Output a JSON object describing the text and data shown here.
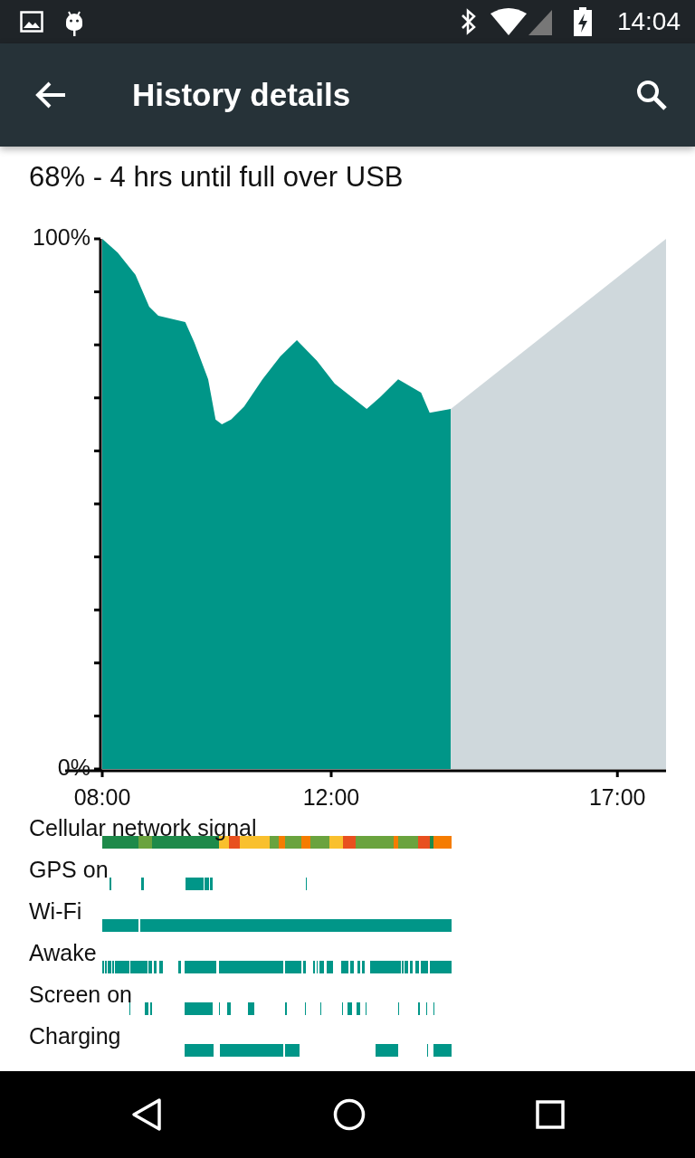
{
  "status_bar": {
    "time": "14:04"
  },
  "toolbar": {
    "title": "History details"
  },
  "summary": "68% - 4 hrs until full over USB",
  "chart": {
    "chart_data": {
      "type": "area",
      "x": [
        8.0,
        8.27,
        8.58,
        8.82,
        8.98,
        9.45,
        9.61,
        9.85,
        9.98,
        10.09,
        10.25,
        10.48,
        10.8,
        11.11,
        11.4,
        11.75,
        12.06,
        12.62,
        12.85,
        13.17,
        13.57,
        13.72,
        14.09,
        17.85
      ],
      "xlim": [
        8,
        17.85
      ],
      "ylim": [
        0,
        100
      ],
      "xticks": [
        {
          "value": 8,
          "label": "08:00"
        },
        {
          "value": 12,
          "label": "12:00"
        },
        {
          "value": 17,
          "label": "17:00"
        }
      ],
      "yticks": [
        {
          "value": 100,
          "label": "100%"
        },
        {
          "value": 0,
          "label": "0%"
        }
      ],
      "series": [
        {
          "color": "#009688",
          "values": [
            100,
            97.4,
            93.2,
            87.2,
            85.5,
            84.3,
            80.4,
            73.5,
            65.9,
            65,
            65.9,
            68.4,
            73.5,
            77.8,
            80.9,
            77,
            72.7,
            67.9,
            70.1,
            73.5,
            71,
            67.2,
            67.9,
            null
          ]
        },
        {
          "color": "#cfd8dc",
          "values": [
            null,
            null,
            null,
            null,
            null,
            null,
            null,
            null,
            null,
            null,
            null,
            null,
            null,
            null,
            null,
            null,
            null,
            null,
            null,
            null,
            null,
            null,
            67.9,
            100
          ]
        }
      ]
    }
  },
  "timeline": [
    {
      "label": "Cellular network signal",
      "kind": "signal"
    },
    {
      "label": "GPS on",
      "kind": "gps"
    },
    {
      "label": "Wi-Fi",
      "kind": "wifi"
    },
    {
      "label": "Awake",
      "kind": "awake"
    },
    {
      "label": "Screen on",
      "kind": "screen"
    },
    {
      "label": "Charging",
      "kind": "charging"
    }
  ]
}
